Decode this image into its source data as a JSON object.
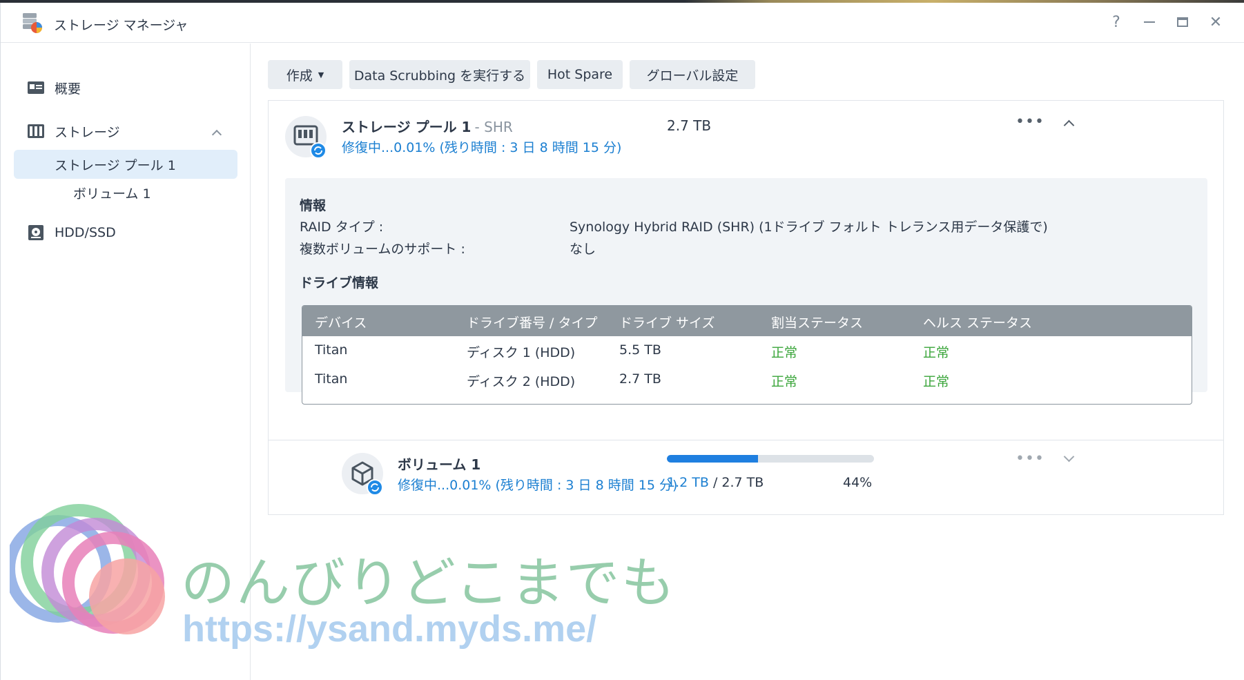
{
  "window": {
    "title": "ストレージ マネージャ"
  },
  "sidebar": {
    "items": [
      {
        "label": "概要",
        "icon": "overview-icon"
      },
      {
        "label": "ストレージ",
        "icon": "storage-icon"
      },
      {
        "label": "ストレージ プール 1"
      },
      {
        "label": "ボリューム 1"
      },
      {
        "label": "HDD/SSD",
        "icon": "hdd-icon"
      }
    ]
  },
  "toolbar": {
    "create": "作成",
    "scrub": "Data Scrubbing を実行する",
    "hotspare": "Hot Spare",
    "global": "グローバル設定"
  },
  "pool": {
    "name": "ストレージ プール 1",
    "type": "- SHR",
    "size": "2.7 TB",
    "status": "修復中...0.01% (残り時間 : 3 日 8 時間 15 分)",
    "info_heading": "情報",
    "raid_label": "RAID タイプ :",
    "raid_value": "Synology Hybrid RAID (SHR) (1ドライブ フォルト トレランス用データ保護で)",
    "multi_label": "複数ボリュームのサポート :",
    "multi_value": "なし",
    "drive_heading": "ドライブ情報",
    "columns": [
      "デバイス",
      "ドライブ番号 / タイプ",
      "ドライブ サイズ",
      "割当ステータス",
      "ヘルス ステータス"
    ],
    "rows": [
      [
        "Titan",
        "ディスク 1 (HDD)",
        "5.5 TB",
        "正常",
        "正常"
      ],
      [
        "Titan",
        "ディスク 2 (HDD)",
        "2.7 TB",
        "正常",
        "正常"
      ]
    ]
  },
  "volume": {
    "name": "ボリューム 1",
    "status": "修復中...0.01% (残り時間 : 3 日 8 時間 15 分)",
    "used": "1.2 TB",
    "sep": " / ",
    "total": "2.7 TB",
    "percent": "44%",
    "fraction": 0.44
  },
  "watermark": {
    "text": "のんびりどこまでも",
    "url": "https://ysand.myds.me/"
  },
  "colors": {
    "accent": "#1f7fe0",
    "ok": "#3aa53a",
    "header": "#8f989f"
  }
}
